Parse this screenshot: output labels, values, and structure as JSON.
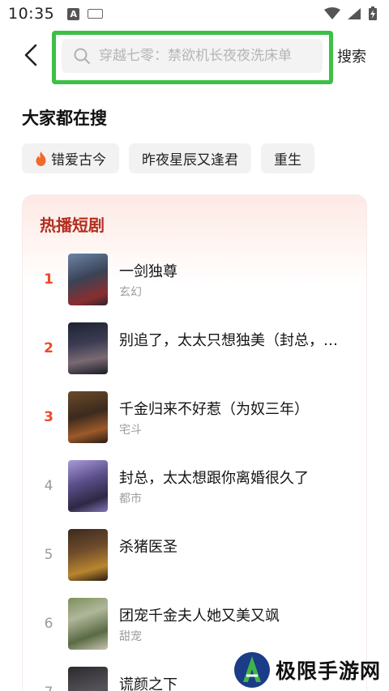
{
  "status_bar": {
    "time": "10:35",
    "a_icon_label": "A"
  },
  "search": {
    "placeholder": "穿越七零：禁欲机长夜夜洗床单",
    "button_label": "搜索"
  },
  "trending": {
    "title": "大家都在搜",
    "chips": [
      {
        "label": "错爱古今",
        "icon": "fire-icon"
      },
      {
        "label": "昨夜星辰又逢君"
      },
      {
        "label": "重生"
      }
    ]
  },
  "hot_dramas": {
    "title": "热播短剧",
    "items": [
      {
        "rank": "1",
        "title": "一剑独尊",
        "genre": "玄幻"
      },
      {
        "rank": "2",
        "title": "别追了，太太只想独美（封总，…",
        "genre": ""
      },
      {
        "rank": "3",
        "title": "千金归来不好惹（为奴三年）",
        "genre": "宅斗"
      },
      {
        "rank": "4",
        "title": "封总，太太想跟你离婚很久了",
        "genre": "都市"
      },
      {
        "rank": "5",
        "title": "杀猪医圣",
        "genre": ""
      },
      {
        "rank": "6",
        "title": "团宠千金夫人她又美又飒",
        "genre": "甜宠"
      },
      {
        "rank": "7",
        "title": "谎颜之下",
        "genre": ""
      }
    ]
  },
  "watermark": {
    "text": "极限手游网"
  },
  "colors": {
    "highlight_border": "#3cbf46",
    "rank_top": "#f0482b",
    "hot_title": "#b32e1f"
  }
}
